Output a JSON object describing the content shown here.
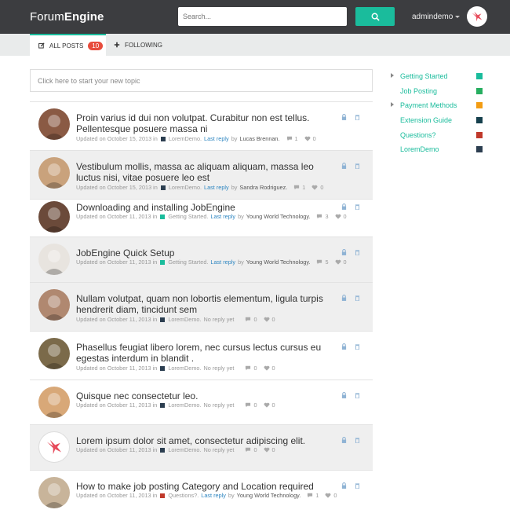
{
  "header": {
    "logo_light": "Forum",
    "logo_bold": "Engine",
    "search_placeholder": "Search...",
    "username": "admindemo"
  },
  "tabs": {
    "all_posts": "ALL POSTS",
    "all_count": "10",
    "following": "FOLLOWING"
  },
  "new_topic_placeholder": "Click here to start your new topic",
  "posts": [
    {
      "title": "Proin varius id dui non volutpat. Curabitur non est tellus. Pellentesque posuere massa ni",
      "updated": "Updated on October 15, 2013 in",
      "category": "LoremDemo.",
      "cat_color": "#2c3e50",
      "reply": "Last reply",
      "by": "by",
      "author": "Lucas Brennan.",
      "comments": "1",
      "likes": "0"
    },
    {
      "title": "Vestibulum mollis, massa ac aliquam aliquam, massa leo luctus nisi, vitae posuere leo est",
      "updated": "Updated on October 15, 2013 in",
      "category": "LoremDemo.",
      "cat_color": "#2c3e50",
      "reply": "Last reply",
      "by": "by",
      "author": "Sandra Rodriguez.",
      "comments": "1",
      "likes": "0"
    },
    {
      "title": "Downloading and installing JobEngine",
      "updated": "Updated on October 11, 2013 in",
      "category": "Getting Started.",
      "cat_color": "#1abc9c",
      "reply": "Last reply",
      "by": "by",
      "author": "Young World Technology.",
      "comments": "3",
      "likes": "0"
    },
    {
      "title": "JobEngine Quick Setup",
      "updated": "Updated on October 11, 2013 in",
      "category": "Getting Started.",
      "cat_color": "#1abc9c",
      "reply": "Last reply",
      "by": "by",
      "author": "Young World Technology.",
      "comments": "5",
      "likes": "0"
    },
    {
      "title": "Nullam volutpat, quam non lobortis elementum, ligula turpis hendrerit diam, tincidunt sem",
      "updated": "Updated on October 11, 2013 in",
      "category": "LoremDemo.",
      "cat_color": "#2c3e50",
      "reply": "No reply yet",
      "by": "",
      "author": "",
      "comments": "0",
      "likes": "0"
    },
    {
      "title": "Phasellus feugiat libero lorem, nec cursus lectus cursus eu egestas interdum in blandit .",
      "updated": "Updated on October 11, 2013 in",
      "category": "LoremDemo.",
      "cat_color": "#2c3e50",
      "reply": "No reply yet",
      "by": "",
      "author": "",
      "comments": "0",
      "likes": "0"
    },
    {
      "title": "Quisque nec consectetur leo.",
      "updated": "Updated on October 11, 2013 in",
      "category": "LoremDemo.",
      "cat_color": "#2c3e50",
      "reply": "No reply yet",
      "by": "",
      "author": "",
      "comments": "0",
      "likes": "0"
    },
    {
      "title": "Lorem ipsum dolor sit amet, consectetur adipiscing elit.",
      "updated": "Updated on October 11, 2013 in",
      "category": "LoremDemo.",
      "cat_color": "#2c3e50",
      "reply": "No reply yet",
      "by": "",
      "author": "",
      "comments": "0",
      "likes": "0"
    },
    {
      "title": "How to make job posting Category and Location required",
      "updated": "Updated on October 11, 2013 in",
      "category": "Questions?.",
      "cat_color": "#c0392b",
      "reply": "Last reply",
      "by": "by",
      "author": "Young World Technology.",
      "comments": "1",
      "likes": "0"
    }
  ],
  "categories": [
    {
      "label": "Getting Started",
      "color": "#1abc9c",
      "arrow": true
    },
    {
      "label": "Job Posting",
      "color": "#27ae60",
      "arrow": false
    },
    {
      "label": "Payment Methods",
      "color": "#f39c12",
      "arrow": true
    },
    {
      "label": "Extension Guide",
      "color": "#16404d",
      "arrow": false
    },
    {
      "label": "Questions?",
      "color": "#c0392b",
      "arrow": false
    },
    {
      "label": "LoremDemo",
      "color": "#2c3e50",
      "arrow": false
    }
  ],
  "colors": {
    "accent": "#1abc9c",
    "header": "#3c3d40",
    "badge": "#e74c3c",
    "link": "#2e86c1"
  }
}
